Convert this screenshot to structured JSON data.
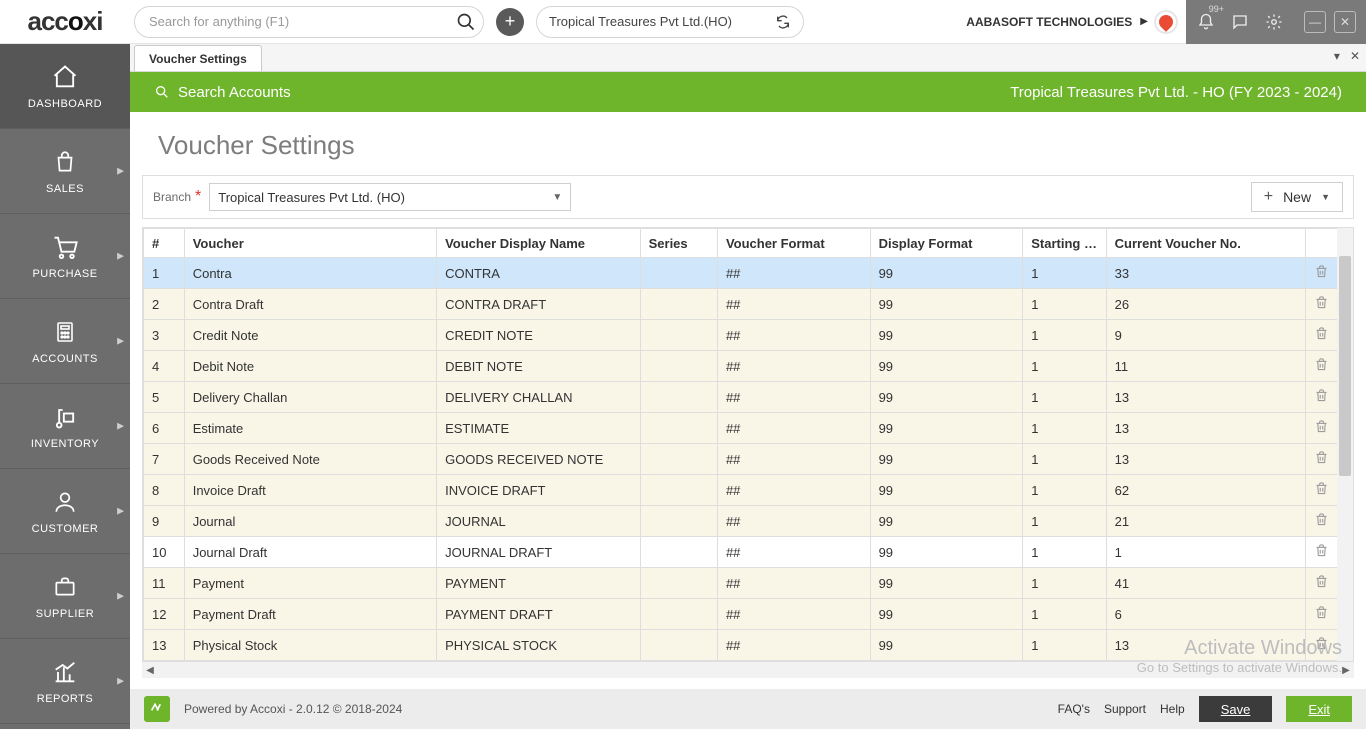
{
  "header": {
    "logo_text": "accoxi",
    "search_placeholder": "Search for anything (F1)",
    "company": "Tropical Treasures Pvt Ltd.(HO)",
    "tenant": "AABASOFT TECHNOLOGIES",
    "notif_badge": "99+"
  },
  "sidebar": {
    "items": [
      {
        "label": "DASHBOARD"
      },
      {
        "label": "SALES"
      },
      {
        "label": "PURCHASE"
      },
      {
        "label": "ACCOUNTS"
      },
      {
        "label": "INVENTORY"
      },
      {
        "label": "CUSTOMER"
      },
      {
        "label": "SUPPLIER"
      },
      {
        "label": "REPORTS"
      }
    ]
  },
  "tab": {
    "title": "Voucher Settings"
  },
  "greenbar": {
    "search_accounts": "Search Accounts",
    "context": "Tropical Treasures Pvt Ltd. - HO (FY 2023 - 2024)"
  },
  "page": {
    "title": "Voucher Settings",
    "branch_label": "Branch",
    "branch_value": "Tropical Treasures Pvt Ltd. (HO)",
    "new_label": "New"
  },
  "table": {
    "headers": {
      "idx": "#",
      "voucher": "Voucher",
      "display_name": "Voucher Display Name",
      "series": "Series",
      "format": "Voucher Format",
      "display_format": "Display Format",
      "starting": "Starting Vou",
      "current": "Current Voucher No."
    },
    "rows": [
      {
        "idx": "1",
        "voucher": "Contra",
        "display": "CONTRA",
        "series": "",
        "format": "##",
        "dformat": "99",
        "starting": "1",
        "current": "33",
        "sel": true,
        "alt": true
      },
      {
        "idx": "2",
        "voucher": "Contra Draft",
        "display": "CONTRA DRAFT",
        "series": "",
        "format": "##",
        "dformat": "99",
        "starting": "1",
        "current": "26",
        "alt": true
      },
      {
        "idx": "3",
        "voucher": "Credit Note",
        "display": "CREDIT NOTE",
        "series": "",
        "format": "##",
        "dformat": "99",
        "starting": "1",
        "current": "9",
        "alt": true
      },
      {
        "idx": "4",
        "voucher": "Debit Note",
        "display": "DEBIT NOTE",
        "series": "",
        "format": "##",
        "dformat": "99",
        "starting": "1",
        "current": "11",
        "alt": true
      },
      {
        "idx": "5",
        "voucher": "Delivery Challan",
        "display": "DELIVERY CHALLAN",
        "series": "",
        "format": "##",
        "dformat": "99",
        "starting": "1",
        "current": "13",
        "alt": true
      },
      {
        "idx": "6",
        "voucher": "Estimate",
        "display": "ESTIMATE",
        "series": "",
        "format": "##",
        "dformat": "99",
        "starting": "1",
        "current": "13",
        "alt": true
      },
      {
        "idx": "7",
        "voucher": "Goods Received Note",
        "display": "GOODS RECEIVED NOTE",
        "series": "",
        "format": "##",
        "dformat": "99",
        "starting": "1",
        "current": "13",
        "alt": true
      },
      {
        "idx": "8",
        "voucher": "Invoice Draft",
        "display": "INVOICE DRAFT",
        "series": "",
        "format": "##",
        "dformat": "99",
        "starting": "1",
        "current": "62",
        "alt": true
      },
      {
        "idx": "9",
        "voucher": "Journal",
        "display": "JOURNAL",
        "series": "",
        "format": "##",
        "dformat": "99",
        "starting": "1",
        "current": "21",
        "alt": true
      },
      {
        "idx": "10",
        "voucher": "Journal Draft",
        "display": "JOURNAL DRAFT",
        "series": "",
        "format": "##",
        "dformat": "99",
        "starting": "1",
        "current": "1",
        "alt": false
      },
      {
        "idx": "11",
        "voucher": "Payment",
        "display": "PAYMENT",
        "series": "",
        "format": "##",
        "dformat": "99",
        "starting": "1",
        "current": "41",
        "alt": true
      },
      {
        "idx": "12",
        "voucher": "Payment Draft",
        "display": "PAYMENT DRAFT",
        "series": "",
        "format": "##",
        "dformat": "99",
        "starting": "1",
        "current": "6",
        "alt": true
      },
      {
        "idx": "13",
        "voucher": "Physical Stock",
        "display": "PHYSICAL STOCK",
        "series": "",
        "format": "##",
        "dformat": "99",
        "starting": "1",
        "current": "13",
        "alt": true
      }
    ]
  },
  "watermark": {
    "line1": "Activate Windows",
    "line2": "Go to Settings to activate Windows."
  },
  "footer": {
    "powered": "Powered by Accoxi - 2.0.12 © 2018-2024",
    "links": {
      "faqs": "FAQ's",
      "support": "Support",
      "help": "Help"
    },
    "save": "Save",
    "exit": "Exit"
  }
}
